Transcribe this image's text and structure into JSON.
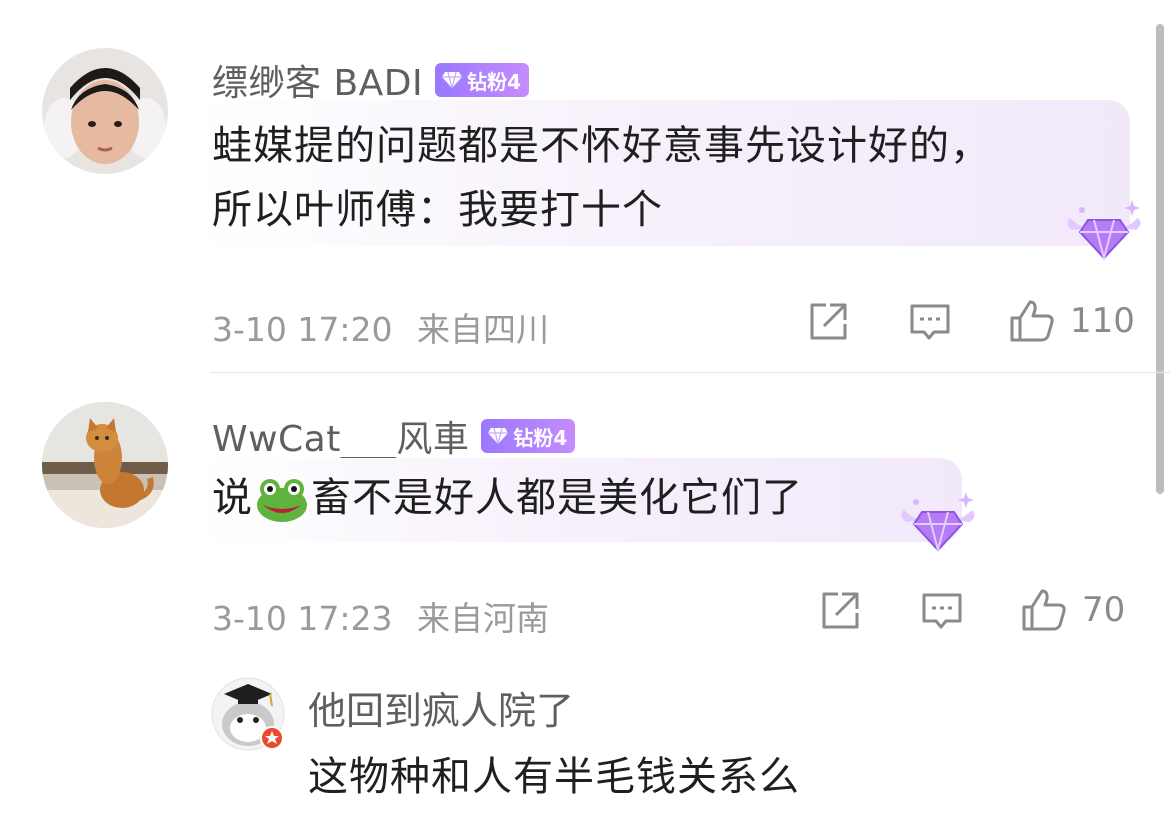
{
  "comments": [
    {
      "username": "缥缈客 BADI",
      "badge": "钻粉4",
      "text_lines": [
        "蛙媒提的问题都是不怀好意事先设计好的，",
        "所以叶师傅：我要打十个"
      ],
      "timestamp": "3-10 17:20",
      "location": "来自四川",
      "likes": "110"
    },
    {
      "username": "WwCat___风車",
      "badge": "钻粉4",
      "text_before_emoji": "说",
      "emoji": "frog-emoji",
      "text_after_emoji": "畜不是好人都是美化它们了",
      "timestamp": "3-10 17:23",
      "location": "来自河南",
      "likes": "70"
    }
  ],
  "reply": {
    "username": "他回到疯人院了",
    "text": "这物种和人有半毛钱关系么"
  },
  "colors": {
    "badge_start": "#9a78ff",
    "badge_end": "#c58cff",
    "username": "#5f5f5f",
    "meta": "#9a9a9a",
    "bubble_tint": "#f1e9fa"
  },
  "icons": [
    "share-icon",
    "comment-icon",
    "like-icon",
    "diamond-decor-icon"
  ]
}
